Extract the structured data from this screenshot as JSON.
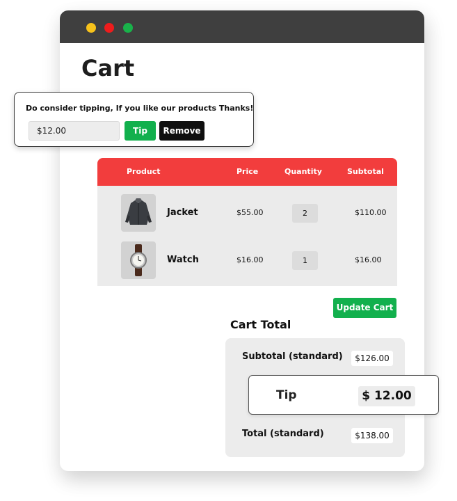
{
  "window": {
    "traffic_lights": [
      "#f7c21b",
      "#ee1c1c",
      "#19b24a"
    ]
  },
  "page": {
    "title": "Cart"
  },
  "tip_popup": {
    "message": "Do consider tipping, If you like our products Thanks!",
    "input_value": "$12.00",
    "tip_button": "Tip",
    "remove_button": "Remove"
  },
  "table": {
    "header_color": "#f23d3d",
    "headers": [
      "Product",
      "Price",
      "Quantity",
      "Subtotal"
    ],
    "rows": [
      {
        "product": "Jacket",
        "icon": "jacket-image",
        "price": "$55.00",
        "quantity": "2",
        "subtotal": "$110.00"
      },
      {
        "product": "Watch",
        "icon": "watch-image",
        "price": "$16.00",
        "quantity": "1",
        "subtotal": "$16.00"
      }
    ]
  },
  "update_button": "Update Cart",
  "cart_total": {
    "heading": "Cart Total",
    "subtotal_label": "Subtotal (standard)",
    "subtotal_value": "$126.00",
    "tip_label": "Tip",
    "tip_value": "$ 12.00",
    "total_label": "Total (standard)",
    "total_value": "$138.00"
  },
  "accent_green": "#12b04d"
}
